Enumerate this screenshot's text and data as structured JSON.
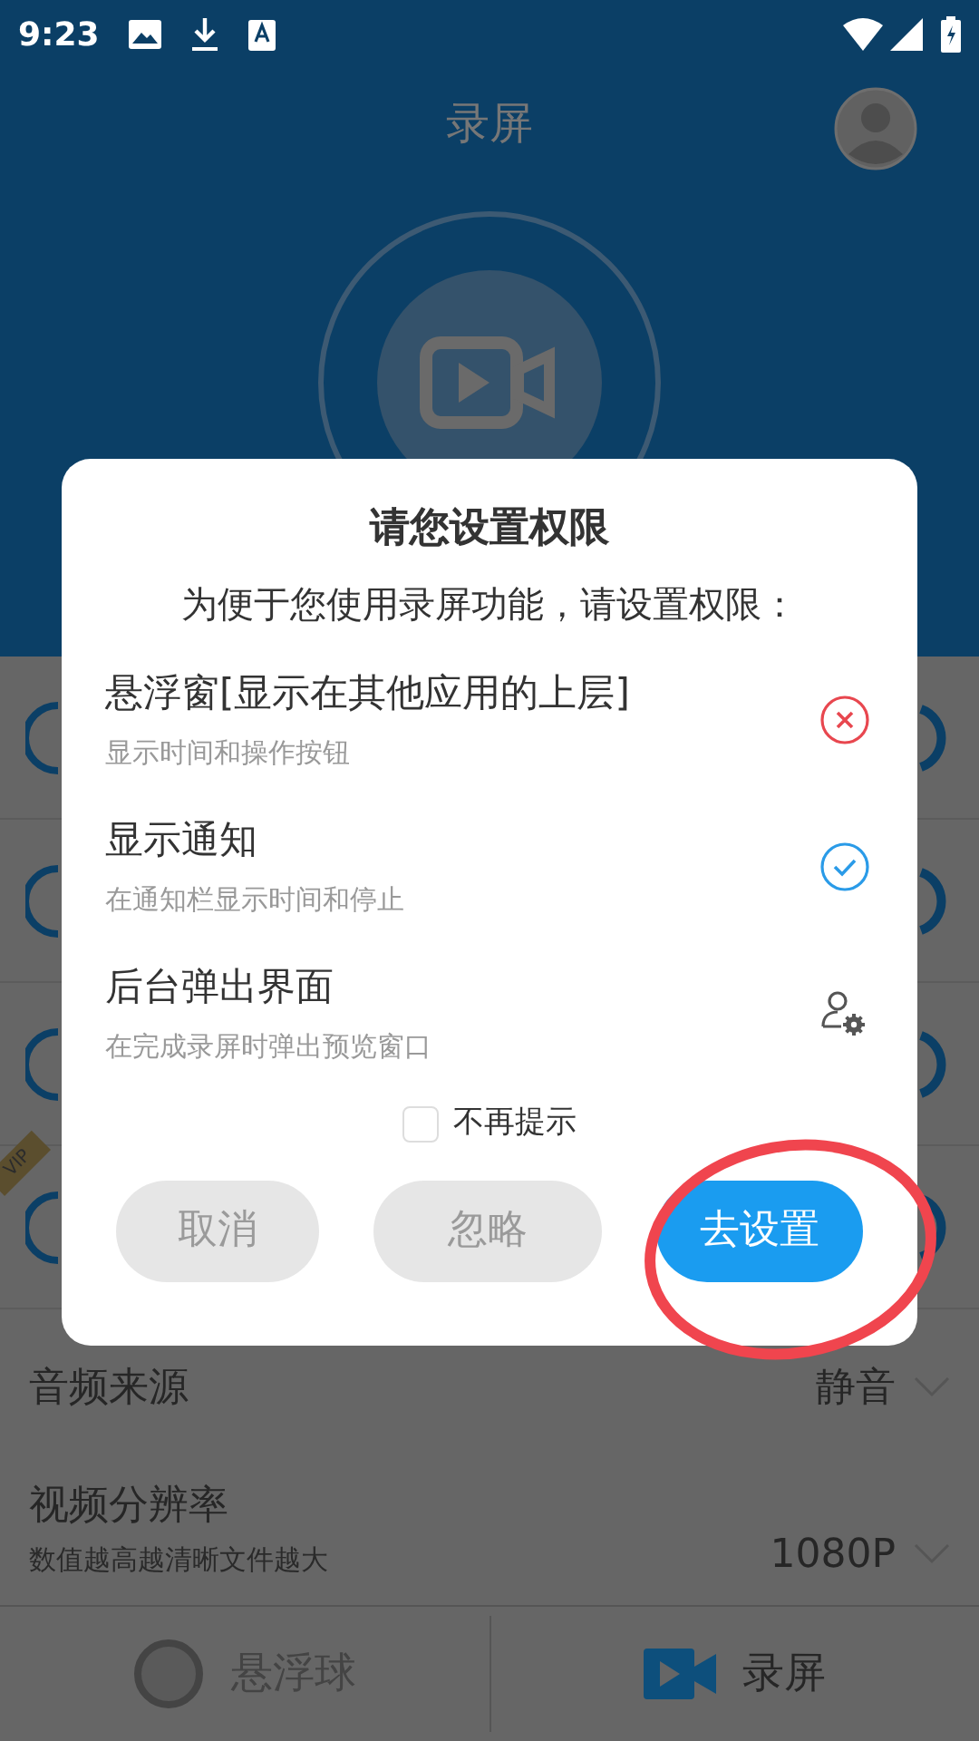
{
  "status_bar": {
    "time": "9:23"
  },
  "header": {
    "title": "录屏"
  },
  "vip_badge": "VIP",
  "dialog": {
    "title": "请您设置权限",
    "subtitle": "为便于您使用录屏功能，请设置权限：",
    "permissions": [
      {
        "title": "悬浮窗[显示在其他应用的上层]",
        "description": "显示时间和操作按钮",
        "kind": "denied"
      },
      {
        "title": "显示通知",
        "description": "在通知栏显示时间和停止",
        "kind": "granted"
      },
      {
        "title": "后台弹出界面",
        "description": "在完成录屏时弹出预览窗口",
        "kind": "manual"
      }
    ],
    "dont_remind": {
      "label": "不再提示",
      "checked": false
    },
    "buttons": [
      {
        "label": "取消",
        "kind": "secondary"
      },
      {
        "label": "忽略",
        "kind": "secondary"
      },
      {
        "label": "去设置",
        "kind": "primary"
      }
    ]
  },
  "settings": [
    {
      "label": "音频来源",
      "value": "静音"
    },
    {
      "label": "视频分辨率",
      "value": "1080P",
      "description": "数值越高越清晰文件越大"
    }
  ],
  "bottom_nav": [
    {
      "label": "悬浮球",
      "kind": "ball",
      "selected": false
    },
    {
      "label": "录屏",
      "kind": "video",
      "selected": true
    }
  ]
}
